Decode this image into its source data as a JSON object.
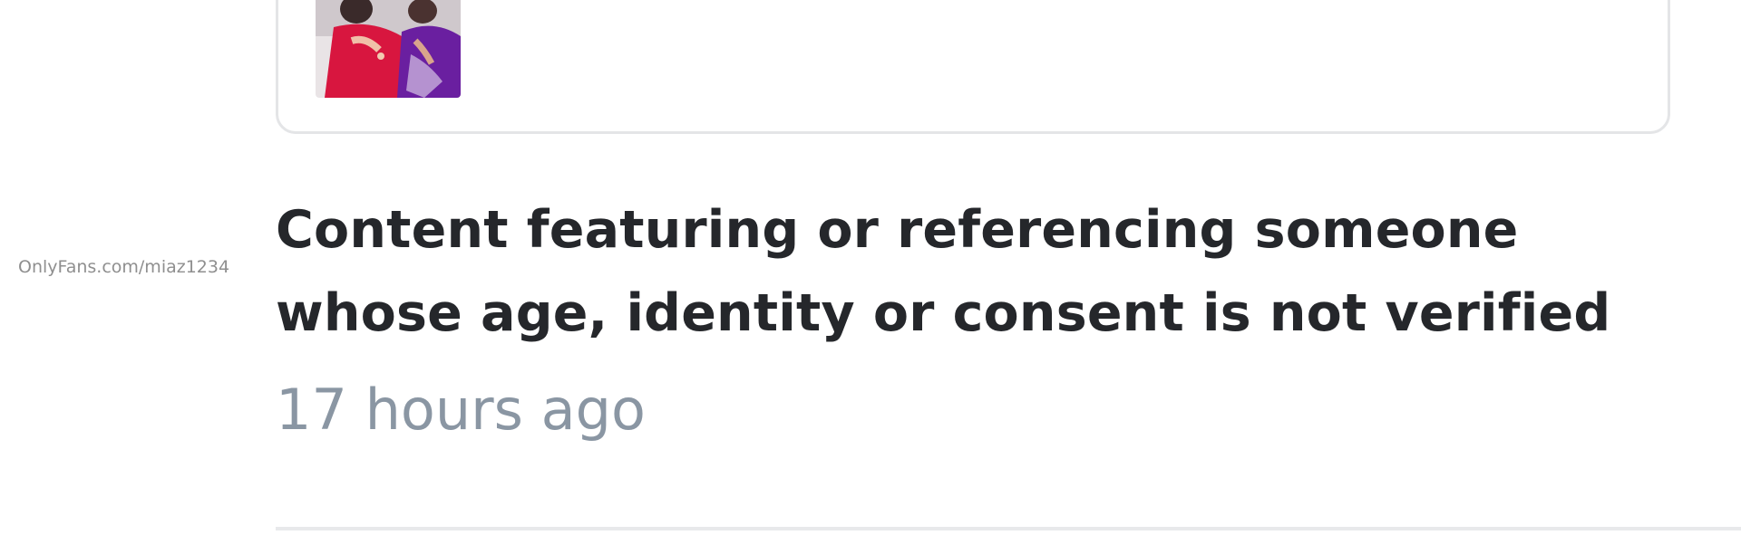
{
  "watermark": "OnlyFans.com/miaz1234",
  "post": {
    "title": "Content featuring or referencing someone whose age, identity or consent is not verified",
    "timestamp": "17 hours ago"
  }
}
